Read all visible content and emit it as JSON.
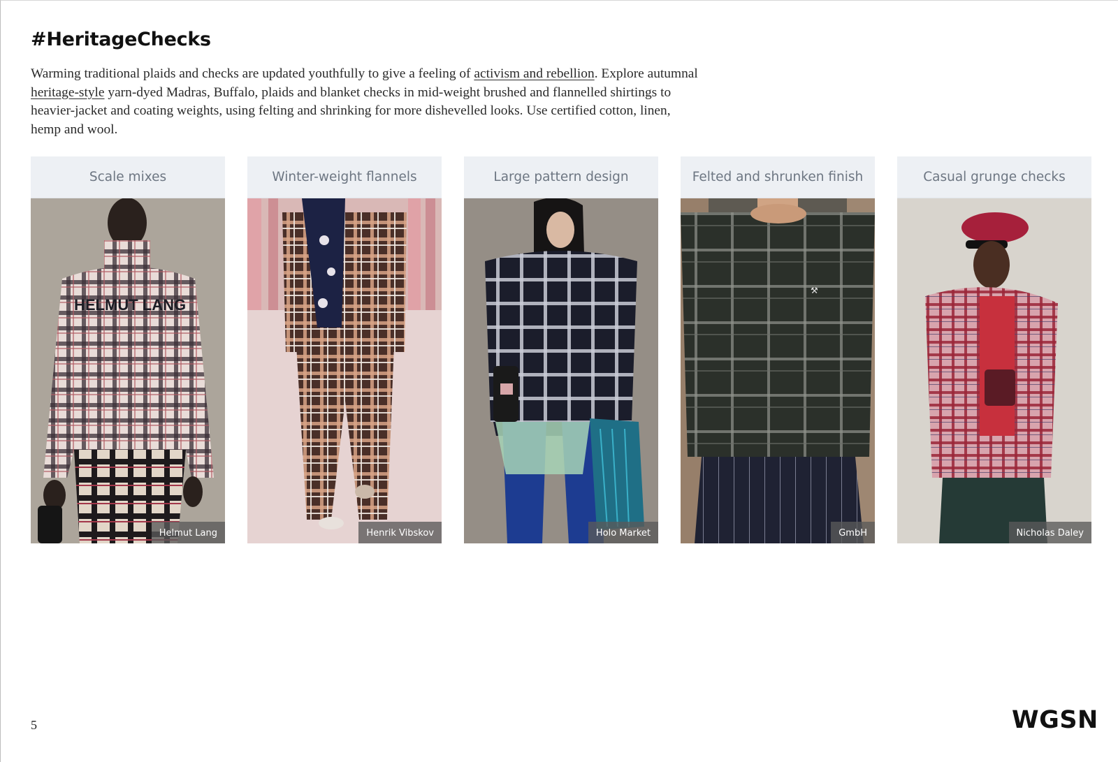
{
  "page": {
    "title": "#HeritageChecks",
    "intro": {
      "part1": "Warming traditional plaids and checks are updated youthfully to give a feeling of ",
      "link1": "activism and rebellion",
      "part2": ". Explore autumnal ",
      "link2": "heritage-style",
      "part3": " yarn-dyed Madras, Buffalo, plaids and blanket checks in mid-weight brushed and flannelled shirtings to heavier-jacket and coating weights, using felting and shrinking for more dishevelled looks. Use certified cotton, linen, hemp and wool."
    },
    "page_number": "5",
    "brand": "WGSN"
  },
  "cards": [
    {
      "label": "Scale mixes",
      "credit": "Helmut Lang",
      "icon": "runway-photo-plaid-sweater"
    },
    {
      "label": "Winter-weight flannels",
      "credit": "Henrik Vibskov",
      "icon": "runway-photo-flannel-suit"
    },
    {
      "label": "Large pattern design",
      "credit": "Holo Market",
      "icon": "street-photo-check-jacket"
    },
    {
      "label": "Felted and shrunken finish",
      "credit": "GmbH",
      "icon": "runway-photo-felted-vest"
    },
    {
      "label": "Casual grunge checks",
      "credit": "Nicholas Daley",
      "icon": "studio-photo-red-check-shirt"
    }
  ],
  "colors": {
    "card_header_bg": "#edf0f4",
    "card_header_text": "#6d7682",
    "credit_bg": "#5a5a5a"
  }
}
